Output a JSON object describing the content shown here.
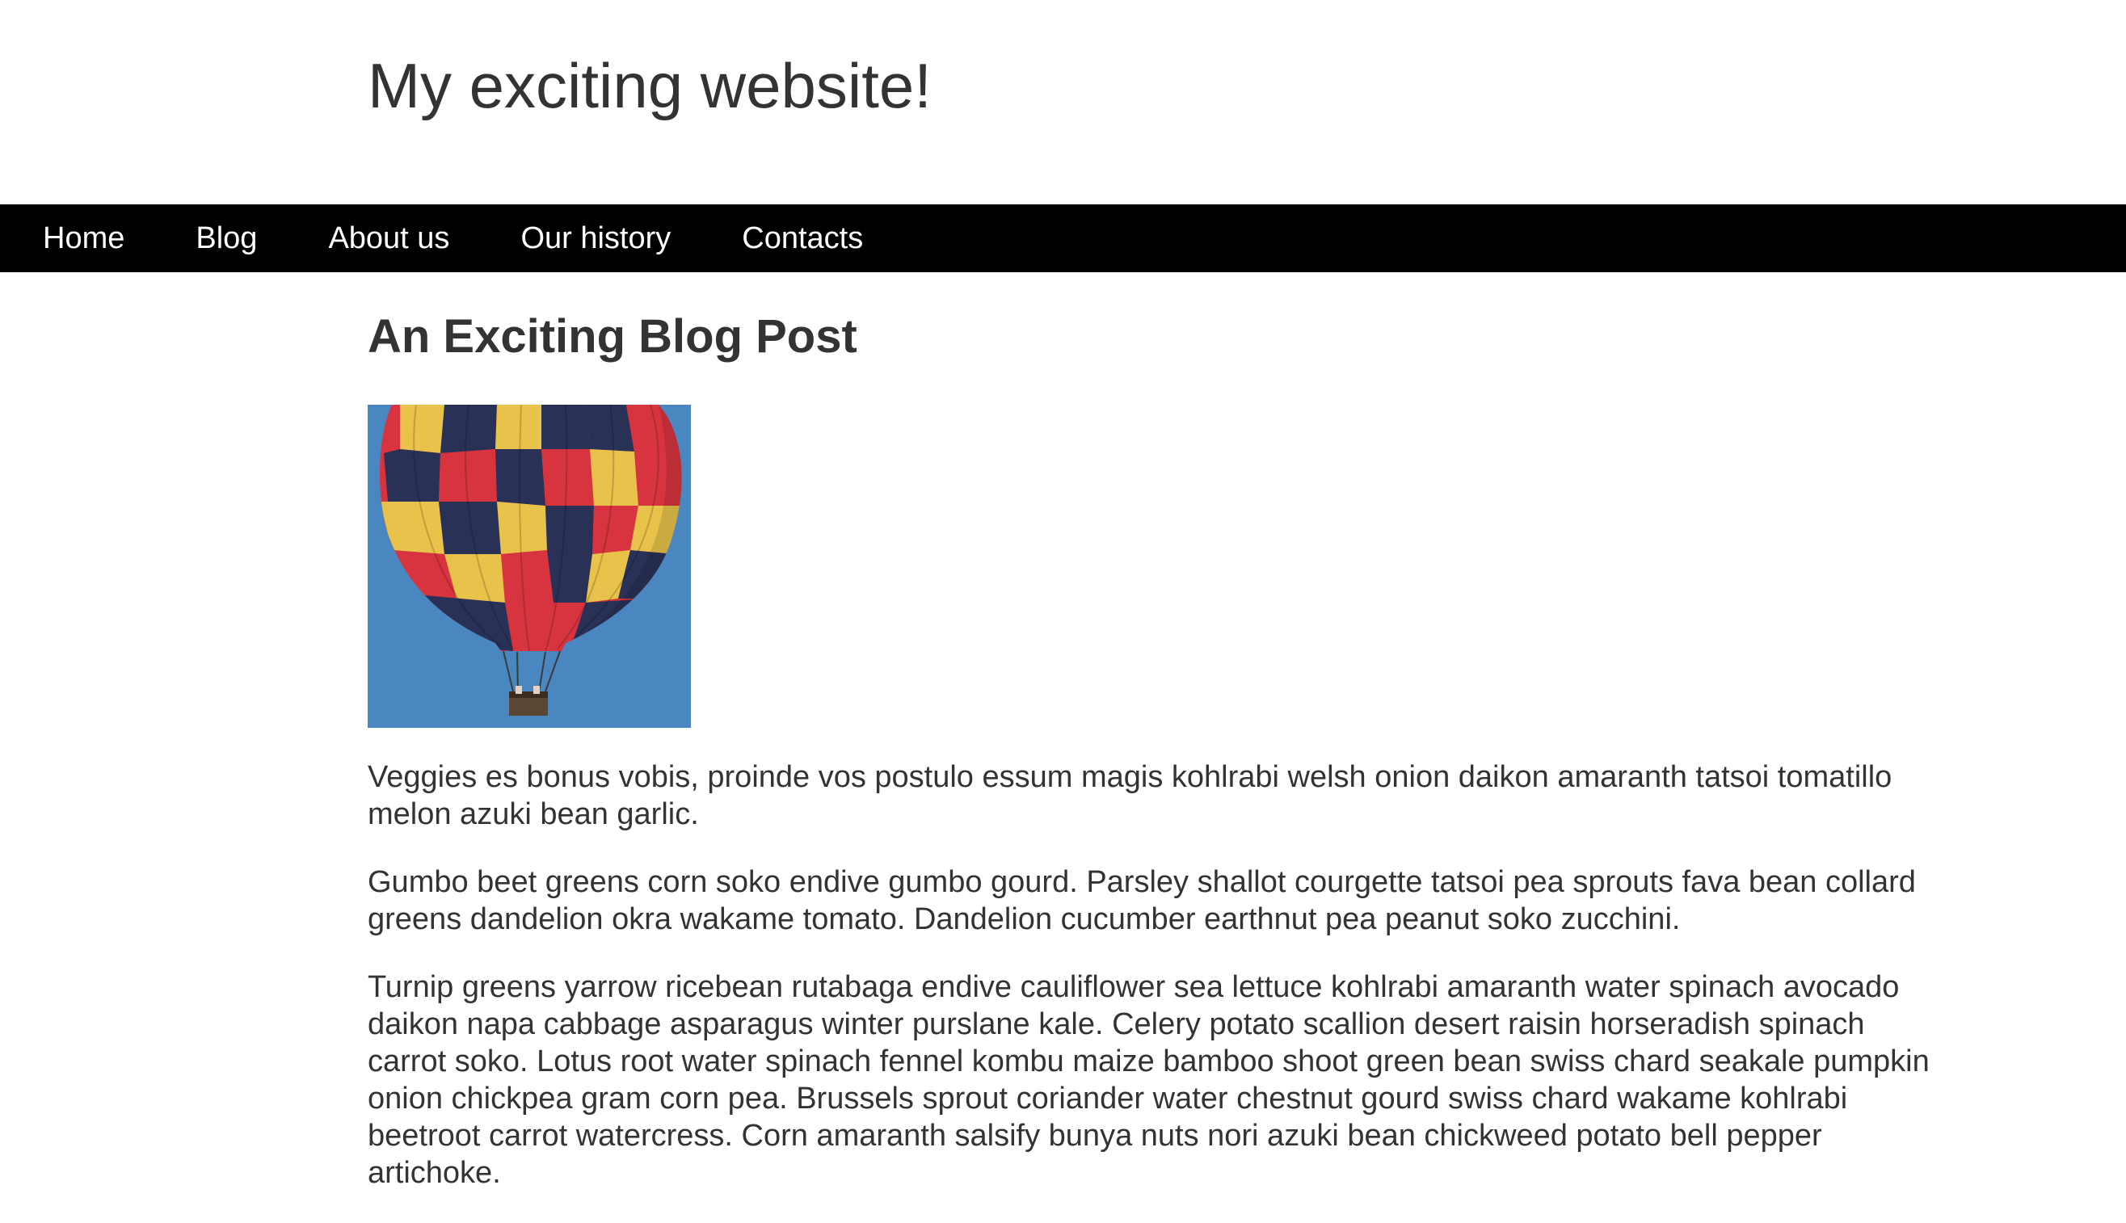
{
  "header": {
    "site_title": "My exciting website!"
  },
  "nav": {
    "items": [
      {
        "label": "Home"
      },
      {
        "label": "Blog"
      },
      {
        "label": "About us"
      },
      {
        "label": "Our history"
      },
      {
        "label": "Contacts"
      }
    ]
  },
  "post": {
    "title": "An Exciting Blog Post",
    "image_icon": "hot-air-balloon-photo",
    "paragraphs": [
      "Veggies es bonus vobis, proinde vos postulo essum magis kohlrabi welsh onion daikon amaranth tatsoi tomatillo melon azuki bean garlic.",
      "Gumbo beet greens corn soko endive gumbo gourd. Parsley shallot courgette tatsoi pea sprouts fava bean collard greens dandelion okra wakame tomato. Dandelion cucumber earthnut pea peanut soko zucchini.",
      "Turnip greens yarrow ricebean rutabaga endive cauliflower sea lettuce kohlrabi amaranth water spinach avocado daikon napa cabbage asparagus winter purslane kale. Celery potato scallion desert raisin horseradish spinach carrot soko. Lotus root water spinach fennel kombu maize bamboo shoot green bean swiss chard seakale pumpkin onion chickpea gram corn pea. Brussels sprout coriander water chestnut gourd swiss chard wakame kohlrabi beetroot carrot watercress. Corn amaranth salsify bunya nuts nori azuki bean chickweed potato bell pepper artichoke."
    ]
  },
  "colors": {
    "nav_background": "#000000",
    "nav_text": "#ffffff",
    "body_text": "#333333",
    "sky": "#4a86c0",
    "balloon_red": "#d8343f",
    "balloon_navy": "#2a3157",
    "balloon_yellow": "#e8c24a"
  }
}
